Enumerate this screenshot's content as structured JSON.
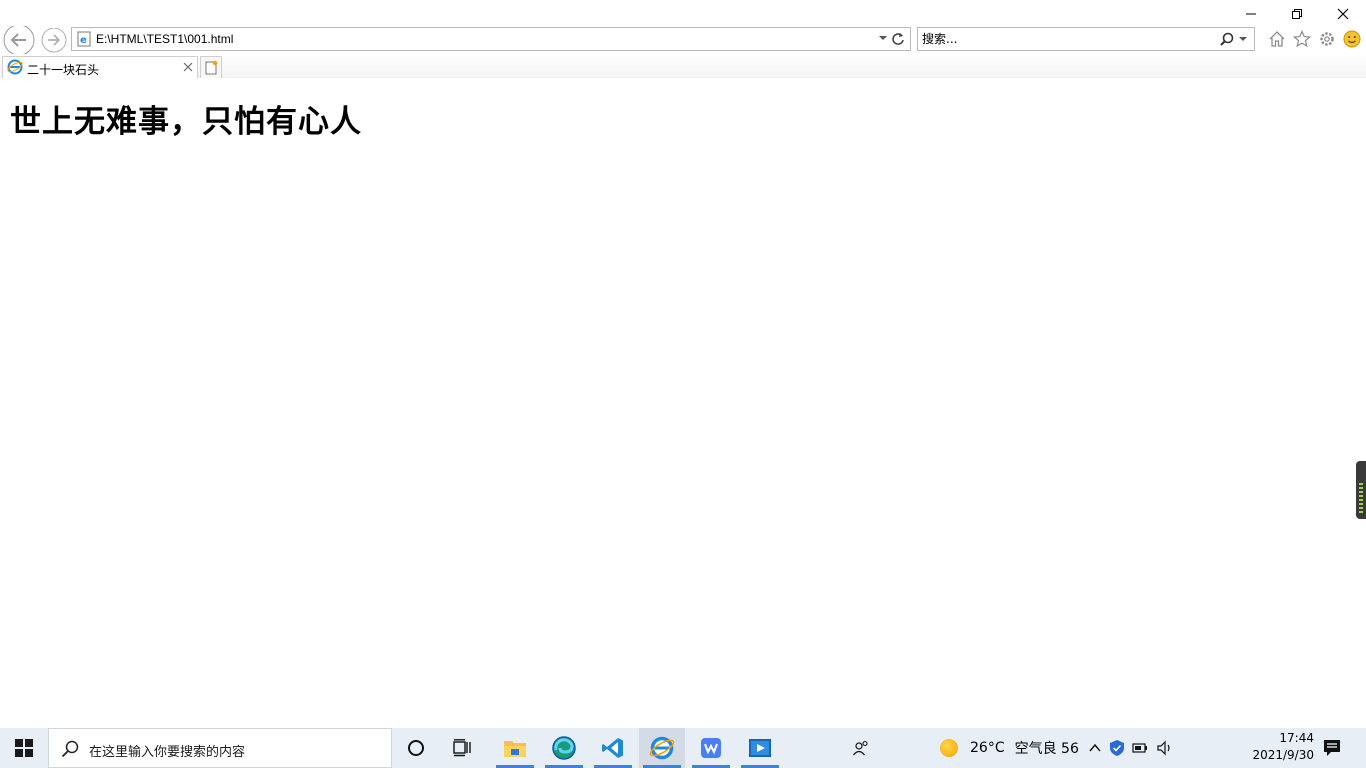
{
  "browser": {
    "address": {
      "url": "E:\\HTML\\TEST1\\001.html"
    },
    "search": {
      "placeholder": "搜索..."
    },
    "tab": {
      "title": "二十一块石头"
    }
  },
  "page": {
    "heading": "世上无难事，只怕有心人"
  },
  "taskbar": {
    "search_placeholder": "在这里输入你要搜索的内容",
    "weather": {
      "temperature": "26°C",
      "air_quality": "空气良 56"
    },
    "clock": {
      "time": "17:44",
      "date": "2021/9/30"
    }
  },
  "colors": {
    "taskbar_bg": "#e8eef5",
    "active_indicator": "#3c82d8",
    "ie_blue": "#1e88e5",
    "accent_yellow": "#f2a200"
  },
  "icons": [
    "back-arrow-icon",
    "forward-arrow-icon",
    "ie-page-icon",
    "dropdown-arrow-icon",
    "refresh-icon",
    "search-icon",
    "home-icon",
    "favorites-star-icon",
    "gear-icon",
    "smiley-icon",
    "close-icon",
    "new-tab-icon",
    "windows-logo-icon",
    "cortana-icon",
    "task-view-icon",
    "file-explorer-icon",
    "edge-icon",
    "vscode-icon",
    "ie-icon",
    "wps-icon",
    "media-player-icon",
    "people-icon",
    "weather-sun-icon",
    "chevron-up-icon",
    "security-shield-icon",
    "network-icon",
    "volume-icon",
    "notification-icon"
  ]
}
